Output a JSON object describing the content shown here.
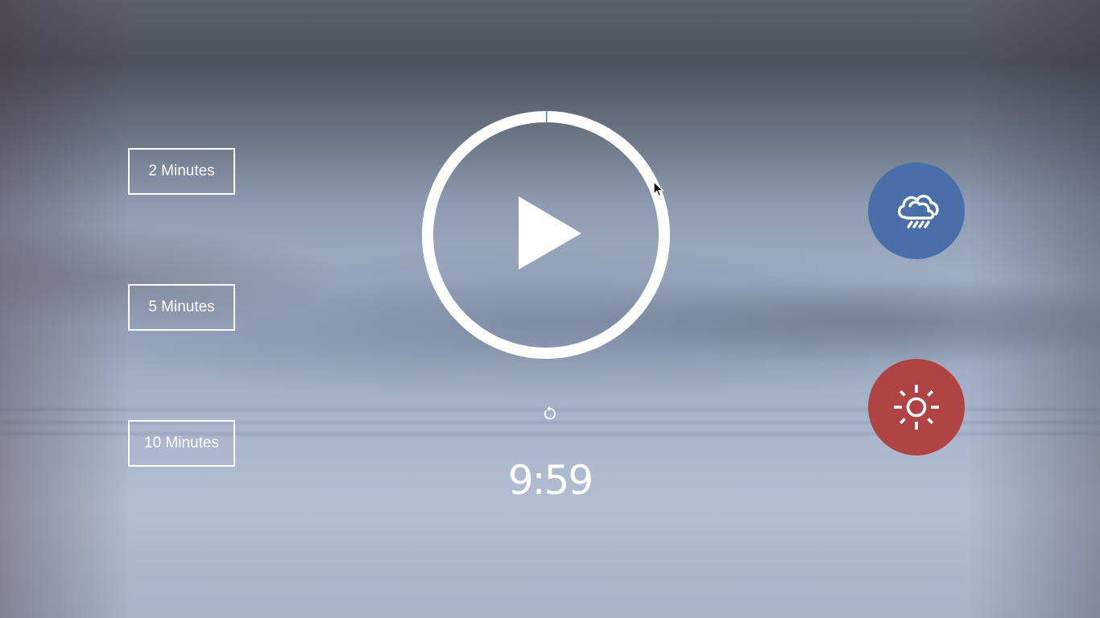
{
  "presets": [
    {
      "label": "2 Minutes"
    },
    {
      "label": "5 Minutes"
    },
    {
      "label": "10 Minutes"
    }
  ],
  "timer": {
    "display": "9:59",
    "progress": 0.0017,
    "state_icon": "play-icon",
    "ring_color": "#ffffff",
    "progress_color": "#4a8fd0"
  },
  "reset_icon": "reset-icon",
  "sounds": [
    {
      "name": "rain",
      "icon": "cloud-rain-icon",
      "color": "#4a6ea8"
    },
    {
      "name": "sun",
      "icon": "sun-icon",
      "color": "#b04445"
    }
  ]
}
